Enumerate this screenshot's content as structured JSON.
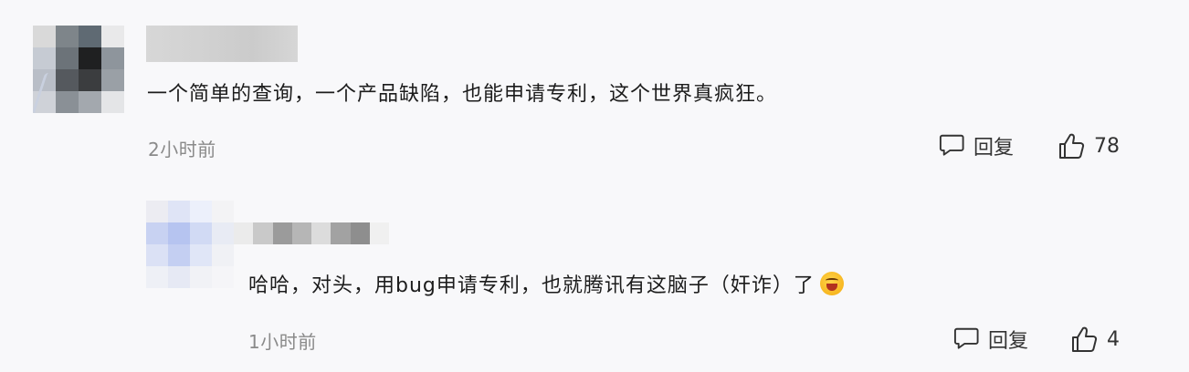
{
  "comments": [
    {
      "text": "一个简单的查询，一个产品缺陷，也能申请专利，这个世界真疯狂。",
      "time": "2小时前",
      "reply_label": "回复",
      "like_count": "78",
      "avatar_colors": [
        "#d9d9d9",
        "#7e858a",
        "#5f6a73",
        "#e9e9ea",
        "#c6cbd3",
        "#6c7379",
        "#1f2021",
        "#8e959c",
        "#b9bec7",
        "#55595e",
        "#3b3d3f",
        "#9aa0a6",
        "#cfd2d8",
        "#8a9096",
        "#a3a8ae",
        "#e4e5e7"
      ]
    },
    {
      "text": "哈哈，对头，用bug申请专利，也就腾讯有这脑子（奸诈）了",
      "time": "1小时前",
      "reply_label": "回复",
      "like_count": "4",
      "emoji": "laughing-face",
      "avatar_colors": [
        "#ececf2",
        "#dfe4f6",
        "#ecf0fb",
        "#f3f3f5",
        "#c8d2f2",
        "#b6c4f0",
        "#d1daf4",
        "#e8ebf4",
        "#dbe1f5",
        "#c4cff2",
        "#e0e6f7",
        "#f0f1f5",
        "#eef0f6",
        "#e6e9f4",
        "#f1f2f6",
        "#f5f5f8"
      ],
      "username_colors": [
        "#ebebeb",
        "#c9c9c9",
        "#9b9b9b",
        "#b6b6b6",
        "#dcdcdc",
        "#a2a2a2",
        "#8e8e8e",
        "#f0f0f0"
      ]
    }
  ],
  "icons": {
    "reply": "comment-bubble-icon",
    "like": "thumbs-up-icon"
  }
}
